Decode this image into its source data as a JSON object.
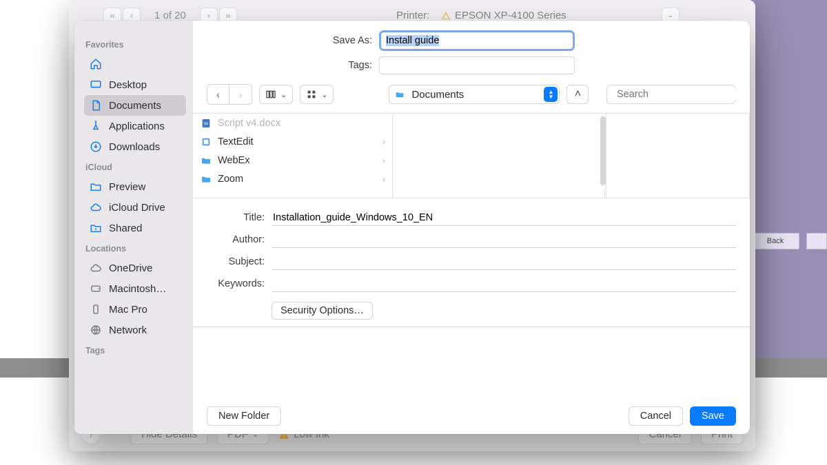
{
  "background": {
    "print_page_indicator": "1 of 20",
    "printer_label": "Printer:",
    "printer_value": "EPSON XP-4100 Series",
    "help": "?",
    "hide_details": "Hide Details",
    "pdf": "PDF",
    "low_ink": "Low Ink",
    "cancel": "Cancel",
    "print": "Print",
    "back_btn": "Back"
  },
  "sidebar": {
    "favorites_header": "Favorites",
    "favorites": [
      {
        "label": "",
        "icon": "home"
      },
      {
        "label": "Desktop",
        "icon": "desktop"
      },
      {
        "label": "Documents",
        "icon": "doc",
        "selected": true
      },
      {
        "label": "Applications",
        "icon": "apps"
      },
      {
        "label": "Downloads",
        "icon": "download"
      }
    ],
    "icloud_header": "iCloud",
    "icloud": [
      {
        "label": "Preview",
        "icon": "folder"
      },
      {
        "label": "iCloud Drive",
        "icon": "cloud"
      },
      {
        "label": "Shared",
        "icon": "shared"
      }
    ],
    "locations_header": "Locations",
    "locations": [
      {
        "label": "OneDrive",
        "icon": "cloud-grey"
      },
      {
        "label": "Macintosh…",
        "icon": "disk"
      },
      {
        "label": "Mac Pro",
        "icon": "tower"
      },
      {
        "label": "Network",
        "icon": "globe"
      }
    ],
    "tags_header": "Tags"
  },
  "top_form": {
    "save_as_label": "Save As:",
    "save_as_value": "Install guide",
    "tags_label": "Tags:",
    "tags_value": ""
  },
  "location": {
    "label": "Documents"
  },
  "search": {
    "placeholder": "Search"
  },
  "browser": {
    "items": [
      {
        "label": "Script v4.docx",
        "icon": "word",
        "disabled": true,
        "chevron": false
      },
      {
        "label": "TextEdit",
        "icon": "app",
        "chevron": true
      },
      {
        "label": "WebEx",
        "icon": "folder",
        "chevron": true
      },
      {
        "label": "Zoom",
        "icon": "folder",
        "chevron": true
      }
    ]
  },
  "meta": {
    "title_label": "Title:",
    "title_value": "Installation_guide_Windows_10_EN",
    "author_label": "Author:",
    "author_value": "",
    "subject_label": "Subject:",
    "subject_value": "",
    "keywords_label": "Keywords:",
    "keywords_value": "",
    "security_button": "Security Options…"
  },
  "footer": {
    "new_folder": "New Folder",
    "cancel": "Cancel",
    "save": "Save"
  }
}
